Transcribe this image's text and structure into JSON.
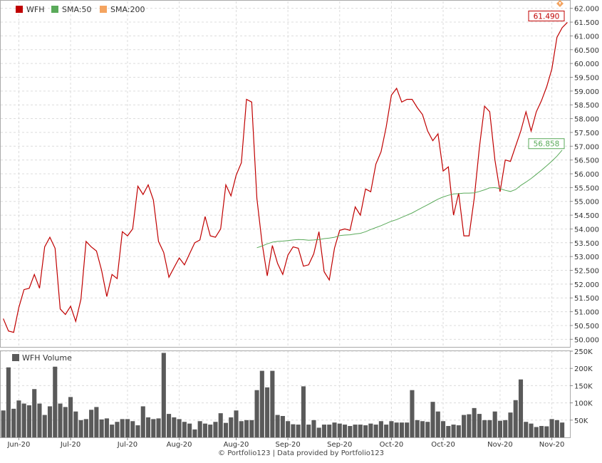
{
  "colors": {
    "price": "#c00000",
    "sma50": "#5aaa5a",
    "sma200": "#f4a460",
    "volume": "#5a5a5a",
    "grid": "#dcdcdc",
    "axis": "#888888",
    "flag": "#f4a460"
  },
  "icons": {
    "alert": "alert-diamond-icon"
  },
  "legend": {
    "items": [
      {
        "label": "WFH",
        "color": "#c00000"
      },
      {
        "label": "SMA:50",
        "color": "#5aaa5a"
      },
      {
        "label": "SMA:200",
        "color": "#f4a460"
      }
    ]
  },
  "volume_legend": {
    "label": "WFH Volume",
    "color": "#5a5a5a"
  },
  "footer": "© Portfolio123 | Data provided by Portfolio123",
  "chart_data": [
    {
      "type": "line",
      "x_tick_labels": [
        "Jun-20",
        "Jul-20",
        "Jul-20",
        "Aug-20",
        "Aug-20",
        "Sep-20",
        "Sep-20",
        "Oct-20",
        "Oct-20",
        "Nov-20",
        "Nov-20"
      ],
      "x_tick_positions": [
        3,
        13,
        24,
        34,
        45,
        55,
        65,
        75,
        85,
        96,
        106
      ],
      "ylim": [
        49.75,
        62.25
      ],
      "y_ticks": [
        "50.000",
        "50.500",
        "51.000",
        "51.500",
        "52.000",
        "52.500",
        "53.000",
        "53.500",
        "54.000",
        "54.500",
        "55.000",
        "55.500",
        "56.000",
        "56.500",
        "57.000",
        "57.500",
        "58.000",
        "58.500",
        "59.000",
        "59.500",
        "60.000",
        "60.500",
        "61.000",
        "61.500",
        "62.000"
      ],
      "grid": true,
      "legend_position": "top-left",
      "last_value_labels": [
        {
          "series": "WFH",
          "text": "61.490"
        },
        {
          "series": "SMA:50",
          "text": "56.858"
        }
      ],
      "series": [
        {
          "name": "WFH",
          "values": [
            50.75,
            50.3,
            50.25,
            51.15,
            51.8,
            51.85,
            52.35,
            51.85,
            53.35,
            53.7,
            53.3,
            51.1,
            50.9,
            51.2,
            50.65,
            51.45,
            53.55,
            53.35,
            53.2,
            52.5,
            51.55,
            52.35,
            52.2,
            53.9,
            53.75,
            54.0,
            55.55,
            55.25,
            55.6,
            55.05,
            53.55,
            53.15,
            52.25,
            52.6,
            52.95,
            52.7,
            53.1,
            53.5,
            53.6,
            54.45,
            53.75,
            53.7,
            54.0,
            55.6,
            55.2,
            55.95,
            56.4,
            58.7,
            58.6,
            55.1,
            53.5,
            52.3,
            53.4,
            52.75,
            52.35,
            53.05,
            53.35,
            53.3,
            52.65,
            52.7,
            53.1,
            53.9,
            52.45,
            52.15,
            53.3,
            53.95,
            54.0,
            53.95,
            54.8,
            54.5,
            55.45,
            55.35,
            56.35,
            56.8,
            57.7,
            58.85,
            59.1,
            58.6,
            58.7,
            58.7,
            58.4,
            58.15,
            57.55,
            57.2,
            57.45,
            56.1,
            56.25,
            54.5,
            55.3,
            53.75,
            53.75,
            55.1,
            56.95,
            58.45,
            58.25,
            56.5,
            55.35,
            56.5,
            56.45,
            57.0,
            57.55,
            58.25,
            57.55,
            58.25,
            58.65,
            59.15,
            59.8,
            60.95,
            61.3,
            61.49
          ]
        },
        {
          "name": "SMA:50",
          "start_index": 49,
          "values": [
            53.32,
            53.38,
            53.46,
            53.52,
            53.55,
            53.56,
            53.58,
            53.6,
            53.62,
            53.61,
            53.59,
            53.6,
            53.62,
            53.65,
            53.67,
            53.7,
            53.76,
            53.78,
            53.79,
            53.82,
            53.84,
            53.9,
            53.98,
            54.05,
            54.12,
            54.2,
            54.28,
            54.34,
            54.42,
            54.5,
            54.58,
            54.68,
            54.78,
            54.88,
            54.98,
            55.08,
            55.16,
            55.22,
            55.27,
            55.28,
            55.3,
            55.3,
            55.31,
            55.36,
            55.42,
            55.49,
            55.5,
            55.46,
            55.4,
            55.36,
            55.43,
            55.58,
            55.7,
            55.83,
            55.98,
            56.13,
            56.29,
            56.46,
            56.64,
            56.86
          ]
        },
        {
          "name": "SMA:200",
          "values": []
        }
      ]
    },
    {
      "type": "bar",
      "title": "WFH Volume",
      "ylim": [
        0,
        250
      ],
      "y_ticks": [
        "50K",
        "100K",
        "150K",
        "200K",
        "250K"
      ],
      "grid": true,
      "series": [
        {
          "name": "WFH Volume",
          "values": [
            78,
            203,
            83,
            107,
            98,
            93,
            140,
            98,
            65,
            90,
            205,
            98,
            88,
            117,
            75,
            50,
            53,
            80,
            88,
            52,
            55,
            37,
            45,
            53,
            53,
            47,
            35,
            90,
            58,
            53,
            55,
            245,
            68,
            58,
            53,
            45,
            40,
            23,
            47,
            40,
            37,
            45,
            70,
            42,
            58,
            78,
            47,
            50,
            50,
            137,
            193,
            145,
            193,
            65,
            62,
            47,
            38,
            37,
            148,
            37,
            50,
            28,
            37,
            37,
            43,
            40,
            37,
            33,
            37,
            37,
            35,
            40,
            37,
            47,
            37,
            47,
            43,
            43,
            43,
            137,
            50,
            47,
            45,
            103,
            75,
            47,
            33,
            37,
            35,
            65,
            67,
            85,
            68,
            50,
            50,
            75,
            48,
            50,
            72,
            108,
            168,
            45,
            40,
            30,
            33,
            32,
            53,
            50,
            43
          ]
        }
      ]
    }
  ]
}
